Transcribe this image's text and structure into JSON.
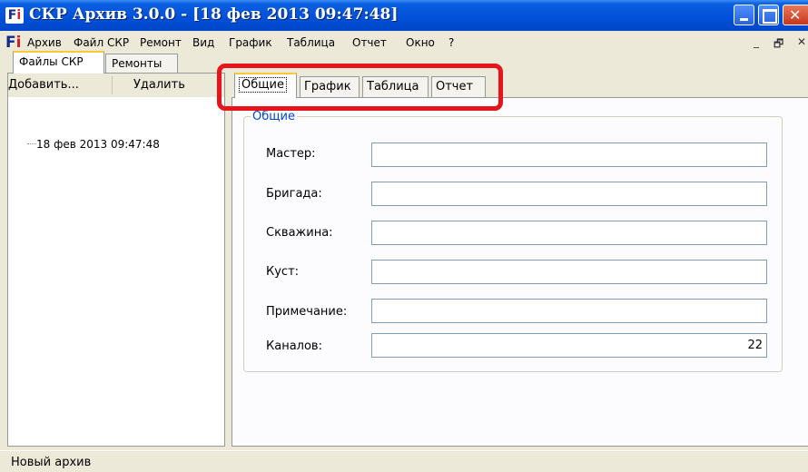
{
  "window": {
    "title": "СКР Архив 3.0.0 - [18 фев 2013 09:47:48]",
    "icon": "Fi"
  },
  "menubar": {
    "icon": "Fi",
    "items": [
      "Архив",
      "Файл СКР",
      "Ремонт",
      "Вид",
      "График",
      "Таблица",
      "Отчет",
      "Окно",
      "?"
    ],
    "mdi_min": "_",
    "mdi_restore": "🗗",
    "mdi_close": "✕"
  },
  "left_panel": {
    "tabs": [
      "Файлы СКР",
      "Ремонты"
    ],
    "active_tab": 0,
    "toolbar": {
      "add_label": "Добавить...",
      "delete_label": "Удалить"
    },
    "tree": [
      "18 фев 2013 09:47:48"
    ]
  },
  "right_panel": {
    "tabs": [
      "Общие",
      "График",
      "Таблица",
      "Отчет"
    ],
    "active_tab": 0,
    "group": {
      "title": "Общие",
      "fields": [
        {
          "label": "Мастер:",
          "value": ""
        },
        {
          "label": "Бригада:",
          "value": ""
        },
        {
          "label": "Скважина:",
          "value": ""
        },
        {
          "label": "Куст:",
          "value": ""
        },
        {
          "label": "Примечание:",
          "value": ""
        },
        {
          "label": "Каналов:",
          "value": "22"
        }
      ]
    }
  },
  "statusbar": {
    "text": "Новый архив"
  },
  "colors": {
    "titlebar": "#0050d8",
    "highlight": "#e8141b",
    "group_title": "#0046d5",
    "tab_accent": "#ffc83c"
  }
}
